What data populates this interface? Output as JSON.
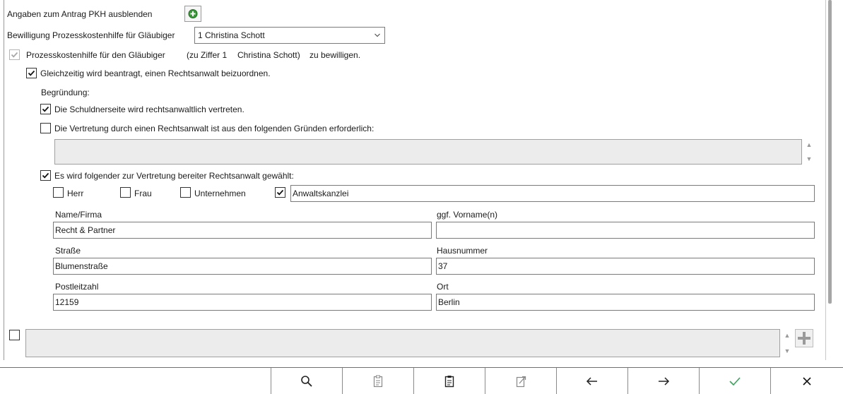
{
  "header": {
    "hide_label": "Angaben zum Antrag PKH ausblenden",
    "add_icon": "green-plus-circle-icon"
  },
  "grant": {
    "label": "Bewilligung Prozesskostenhilfe für Gläubiger",
    "selected": "1 Christina Schott",
    "checkbox_label": "Prozesskostenhilfe für den Gläubiger",
    "ziffer_text": "(zu Ziffer 1",
    "name_text": "Christina Schott)",
    "suffix_text": "zu bewilligen."
  },
  "lawyer": {
    "simultaneous_label": "Gleichzeitig wird beantragt, einen Rechtsanwalt beizuordnen.",
    "reason_heading": "Begründung:",
    "reason1_label": "Die Schuldnerseite wird rechtsanwaltlich vertreten.",
    "reason2_label": "Die Vertretung durch einen Rechtsanwalt ist aus den folgenden Gründen erforderlich:",
    "reason2_text": "",
    "chosen_label": "Es wird folgender zur Vertretung bereiter Rechtsanwalt gewählt:",
    "types": {
      "herr": "Herr",
      "frau": "Frau",
      "unternehmen": "Unternehmen"
    },
    "firm_type_value": "Anwaltskanzlei",
    "fields": {
      "name_label": "Name/Firma",
      "name_value": "Recht & Partner",
      "vorname_label": "ggf. Vorname(n)",
      "vorname_value": "",
      "strasse_label": "Straße",
      "strasse_value": "Blumenstraße",
      "hausnummer_label": "Hausnummer",
      "hausnummer_value": "37",
      "plz_label": "Postleitzahl",
      "plz_value": "12159",
      "ort_label": "Ort",
      "ort_value": "Berlin"
    }
  },
  "extra": {
    "text": ""
  },
  "toolbar": {
    "icons": [
      "search-icon",
      "clipboard-icon",
      "document-icon",
      "export-icon",
      "arrow-left-icon",
      "arrow-right-icon",
      "confirm-check-icon",
      "close-icon"
    ],
    "colors": {
      "accent_check": "#3aa35a",
      "disabled": "#a8a8a8"
    }
  }
}
